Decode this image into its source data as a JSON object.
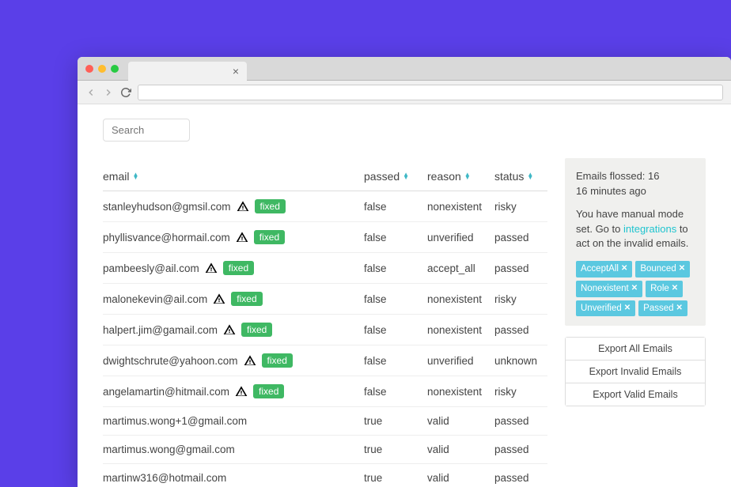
{
  "search": {
    "placeholder": "Search"
  },
  "headers": {
    "email": "email",
    "passed": "passed",
    "reason": "reason",
    "status": "status"
  },
  "rows": [
    {
      "email": "stanleyhudson@gmsil.com",
      "warn": true,
      "fixed": "fixed",
      "passed": "false",
      "reason": "nonexistent",
      "status": "risky"
    },
    {
      "email": "phyllisvance@hormail.com",
      "warn": true,
      "fixed": "fixed",
      "passed": "false",
      "reason": "unverified",
      "status": "passed"
    },
    {
      "email": "pambeesly@ail.com",
      "warn": true,
      "fixed": "fixed",
      "passed": "false",
      "reason": "accept_all",
      "status": "passed"
    },
    {
      "email": "malonekevin@ail.com",
      "warn": true,
      "fixed": "fixed",
      "passed": "false",
      "reason": "nonexistent",
      "status": "risky"
    },
    {
      "email": "halpert.jim@gamail.com",
      "warn": true,
      "fixed": "fixed",
      "passed": "false",
      "reason": "nonexistent",
      "status": "passed"
    },
    {
      "email": "dwightschrute@yahoon.com",
      "warn": true,
      "fixed": "fixed",
      "passed": "false",
      "reason": "unverified",
      "status": "unknown"
    },
    {
      "email": "angelamartin@hitmail.com",
      "warn": true,
      "fixed": "fixed",
      "passed": "false",
      "reason": "nonexistent",
      "status": "risky"
    },
    {
      "email": "martimus.wong+1@gmail.com",
      "warn": false,
      "fixed": null,
      "passed": "true",
      "reason": "valid",
      "status": "passed"
    },
    {
      "email": "martimus.wong@gmail.com",
      "warn": false,
      "fixed": null,
      "passed": "true",
      "reason": "valid",
      "status": "passed"
    },
    {
      "email": "martinw316@hotmail.com",
      "warn": false,
      "fixed": null,
      "passed": "true",
      "reason": "valid",
      "status": "passed"
    }
  ],
  "sidebar": {
    "line1": "Emails flossed: 16",
    "line2": "16 minutes ago",
    "para_a": "You have manual mode set. Go to ",
    "link": "integrations",
    "para_b": " to act on the invalid emails.",
    "tags": [
      "AcceptAll",
      "Bounced",
      "Nonexistent",
      "Role",
      "Unverified",
      "Passed"
    ],
    "exports": [
      "Export All Emails",
      "Export Invalid Emails",
      "Export Valid Emails"
    ]
  }
}
